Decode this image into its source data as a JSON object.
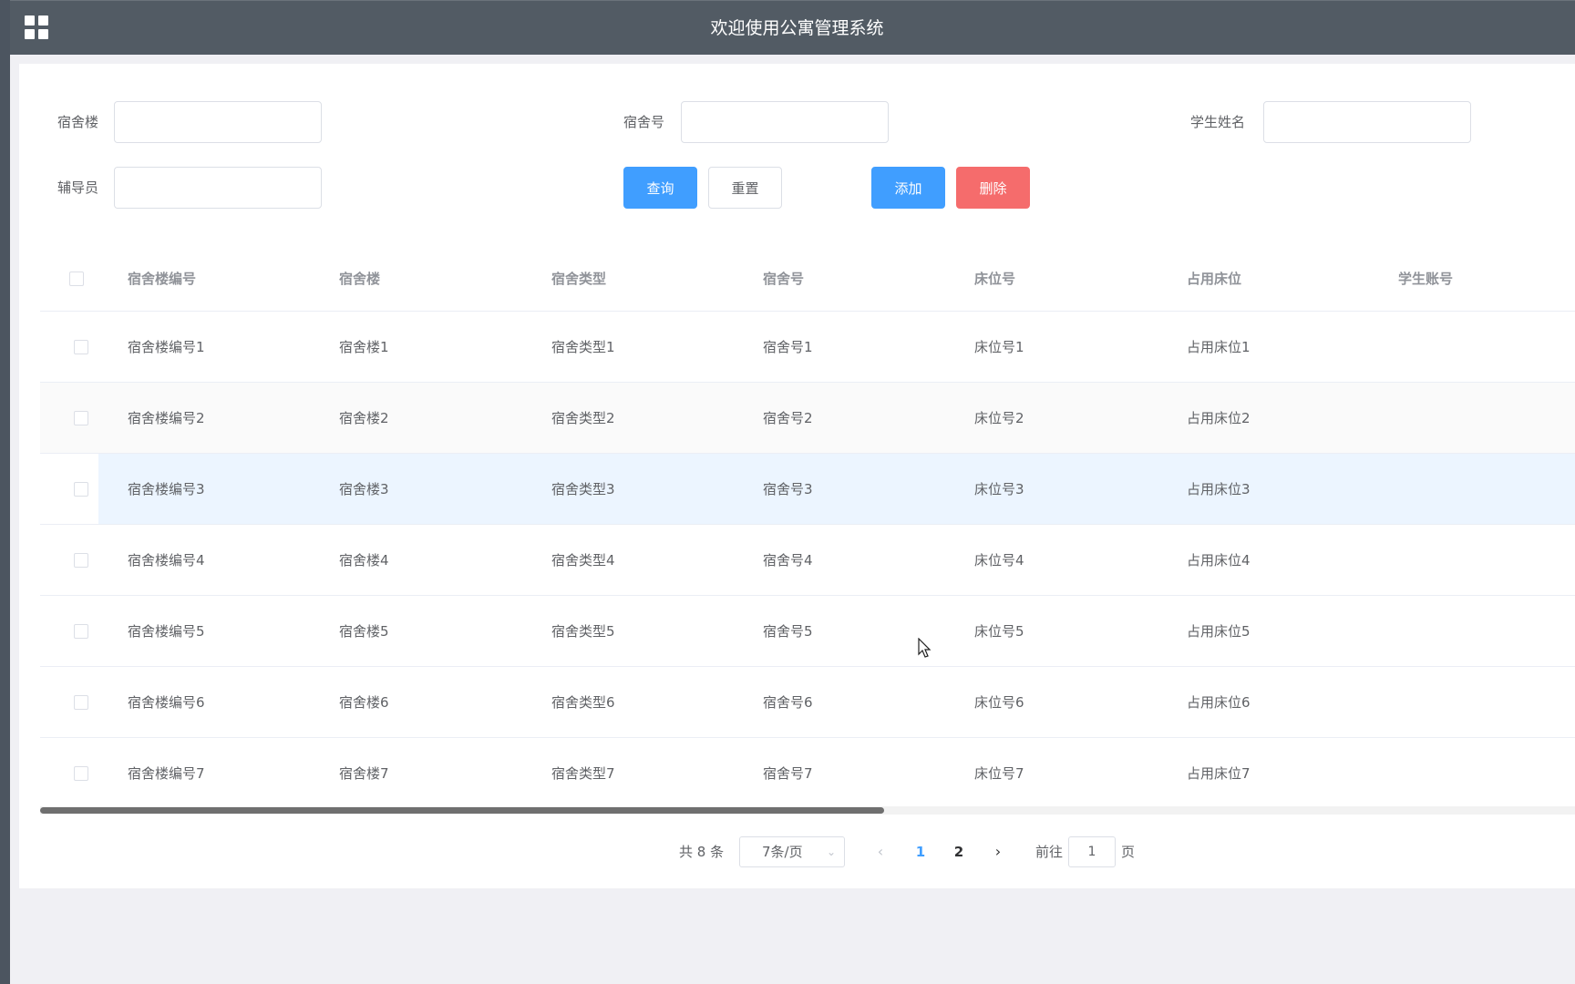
{
  "header": {
    "title": "欢迎使用公寓管理系统",
    "menu_icon": "grid-menu-icon"
  },
  "search": {
    "building_label": "宿舍楼",
    "building_value": "",
    "room_label": "宿舍号",
    "room_value": "",
    "student_name_label": "学生姓名",
    "student_name_value": "",
    "counselor_label": "辅导员",
    "counselor_value": ""
  },
  "toolbar": {
    "query_label": "查询",
    "reset_label": "重置",
    "add_label": "添加",
    "delete_label": "删除"
  },
  "table": {
    "columns": [
      "宿舍楼编号",
      "宿舍楼",
      "宿舍类型",
      "宿舍号",
      "床位号",
      "占用床位",
      "学生账号"
    ],
    "rows": [
      [
        "宿舍楼编号1",
        "宿舍楼1",
        "宿舍类型1",
        "宿舍号1",
        "床位号1",
        "占用床位1",
        ""
      ],
      [
        "宿舍楼编号2",
        "宿舍楼2",
        "宿舍类型2",
        "宿舍号2",
        "床位号2",
        "占用床位2",
        ""
      ],
      [
        "宿舍楼编号3",
        "宿舍楼3",
        "宿舍类型3",
        "宿舍号3",
        "床位号3",
        "占用床位3",
        ""
      ],
      [
        "宿舍楼编号4",
        "宿舍楼4",
        "宿舍类型4",
        "宿舍号4",
        "床位号4",
        "占用床位4",
        ""
      ],
      [
        "宿舍楼编号5",
        "宿舍楼5",
        "宿舍类型5",
        "宿舍号5",
        "床位号5",
        "占用床位5",
        ""
      ],
      [
        "宿舍楼编号6",
        "宿舍楼6",
        "宿舍类型6",
        "宿舍号6",
        "床位号6",
        "占用床位6",
        ""
      ],
      [
        "宿舍楼编号7",
        "宿舍楼7",
        "宿舍类型7",
        "宿舍号7",
        "床位号7",
        "占用床位7",
        ""
      ]
    ],
    "hover_row": 2,
    "horizontal_scroll_fraction": 0.55
  },
  "pagination": {
    "total_text": "共 8 条",
    "page_size_text": "7条/页",
    "pages": [
      "1",
      "2"
    ],
    "current_page": "1",
    "goto_prefix": "前往",
    "goto_value": "1",
    "goto_suffix": "页"
  },
  "colors": {
    "topbar": "#525b64",
    "primary": "#409eff",
    "danger": "#f56c6c",
    "hover_row": "#ecf5ff"
  }
}
